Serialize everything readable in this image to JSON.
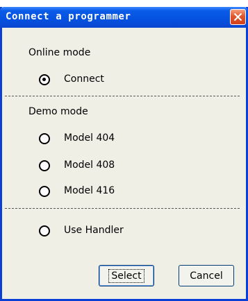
{
  "window": {
    "title": "Connect a programmer"
  },
  "online": {
    "label": "Online mode",
    "options": [
      {
        "label": "Connect",
        "selected": true
      }
    ]
  },
  "demo": {
    "label": "Demo mode",
    "options": [
      {
        "label": "Model 404",
        "selected": false
      },
      {
        "label": "Model 408",
        "selected": false
      },
      {
        "label": "Model 416",
        "selected": false
      }
    ]
  },
  "handler": {
    "label": "Use Handler",
    "selected": false
  },
  "buttons": {
    "select": "Select",
    "cancel": "Cancel"
  },
  "icons": {
    "close": "close-icon"
  },
  "colors": {
    "title_bar": "#0551e0",
    "close_button": "#e2542b",
    "dialog_bg": "#f0efe6"
  }
}
